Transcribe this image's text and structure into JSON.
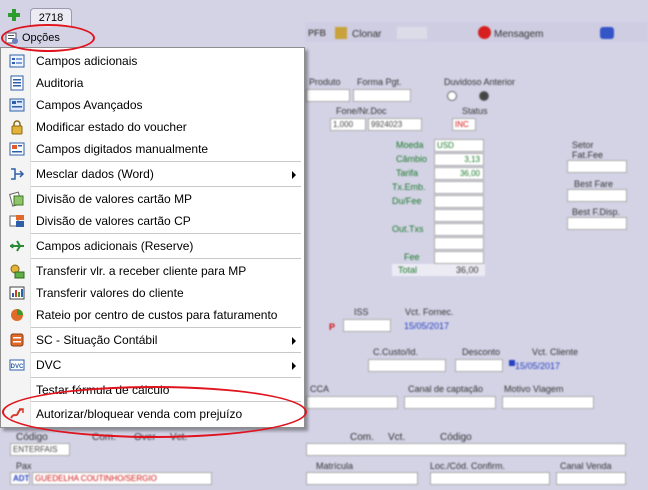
{
  "tab": {
    "label": "2718"
  },
  "options": {
    "label": "Opções"
  },
  "menu": {
    "items": [
      {
        "label": "Campos adicionais",
        "icon": "list-form-icon",
        "submenu": false
      },
      {
        "label": "Auditoria",
        "icon": "audit-list-icon",
        "submenu": false
      },
      {
        "label": "Campos Avançados",
        "icon": "advanced-fields-icon",
        "submenu": false
      },
      {
        "label": "Modificar estado do voucher",
        "icon": "lock-icon",
        "submenu": false
      },
      {
        "label": "Campos digitados manualmente",
        "icon": "manual-entry-icon",
        "submenu": false
      },
      {
        "label": "Mesclar dados (Word)",
        "icon": "merge-icon",
        "submenu": true
      },
      {
        "label": "Divisão de valores cartão MP",
        "icon": "card-split-icon",
        "submenu": false
      },
      {
        "label": "Divisão de valores cartão CP",
        "icon": "card-split-cp-icon",
        "submenu": false
      },
      {
        "label": "Campos adicionais (Reserve)",
        "icon": "airplane-icon",
        "submenu": false
      },
      {
        "label": "Transferir vlr. a receber cliente para MP",
        "icon": "money-transfer-icon",
        "submenu": false
      },
      {
        "label": "Transferir valores do cliente",
        "icon": "client-transfer-icon",
        "submenu": false
      },
      {
        "label": "Rateio por centro de custos para faturamento",
        "icon": "cost-center-icon",
        "submenu": false
      },
      {
        "label": "SC - Situação Contábil",
        "icon": "accounting-icon",
        "submenu": true
      },
      {
        "label": "DVC",
        "icon": "dvc-icon",
        "submenu": true
      },
      {
        "label": "Testar fórmula de cálculo",
        "icon": "",
        "submenu": false
      },
      {
        "label": "Autorizar/bloquear venda com prejuízo",
        "icon": "authorize-sale-icon",
        "submenu": false
      }
    ]
  },
  "background": {
    "toolbar": {
      "clonar": "Clonar",
      "mensagem": "Mensagem"
    },
    "labels": {
      "produto": "Produto",
      "forma_pgt": "Forma Pgt.",
      "duvidoso": "Duvidoso Anterior",
      "moeda": "Moeda",
      "cambio": "Câmbio",
      "tarifa": "Tarifa",
      "tx_emb": "Tx.Emb.",
      "du_fee": "Du/Fee",
      "out_txs": "Out.Txs",
      "fee": "Fee",
      "total": "Total",
      "status": "Status",
      "iss": "ISS",
      "vct_fornec": "Vct. Fornec.",
      "c_custo": "C.Custo/Id.",
      "desconto": "Desconto",
      "vct_cliente": "Vct. Cliente",
      "cca": "CCA",
      "canal_captacao": "Canal de captação",
      "motivo_viagem": "Motivo Viagem",
      "codigo": "Código",
      "com": "Com.",
      "over": "Over",
      "vct": "Vct.",
      "pax": "Pax",
      "matricula": "Matrícula",
      "loc_cod": "Loc./Cód. Confirm.",
      "canal_venda": "Canal Venda",
      "setor": "Setor",
      "fat_fee": "Fat.Fee",
      "best_fare": "Best Fare",
      "best_f_disp": "Best F.Disp."
    },
    "values": {
      "moeda_val": "USD",
      "cambio_val": "3,13",
      "tarifa_val": "36,00",
      "total_val": "36,00",
      "date1": "15/05/2017",
      "date2": "15/05/2017",
      "pax_name": "GUEDELHA COUTINHO/SERGIO",
      "ref": "1,000",
      "ref2": "9924023",
      "status_val": "INC",
      "entr": "ENTERFAIS",
      "pax_id": "ADT"
    }
  }
}
